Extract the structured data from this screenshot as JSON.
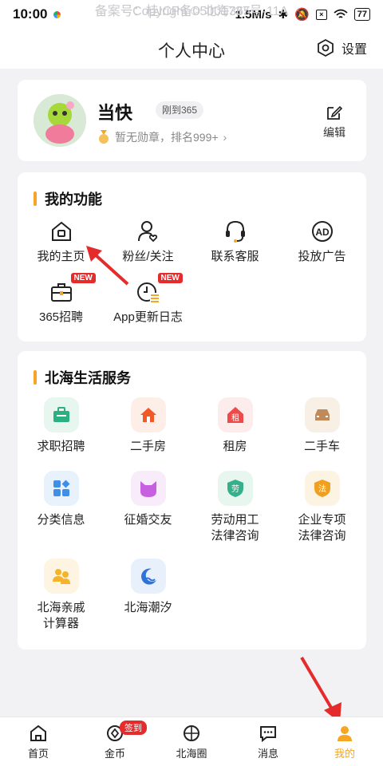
{
  "status": {
    "time": "10:00",
    "speed": "1.5M/s",
    "battery": "77"
  },
  "header": {
    "title": "个人中心",
    "settings_label": "设置"
  },
  "profile": {
    "name": "当快",
    "badge": "刚到365",
    "medal_text": "暂无勋章，排名999+",
    "edit_label": "编辑"
  },
  "functions": {
    "title": "我的功能",
    "items": [
      {
        "label": "我的主页",
        "icon": "home-icon"
      },
      {
        "label": "粉丝/关注",
        "icon": "user-heart-icon"
      },
      {
        "label": "联系客服",
        "icon": "headset-icon"
      },
      {
        "label": "投放广告",
        "icon": "ad-icon"
      },
      {
        "label": "365招聘",
        "icon": "briefcase-icon",
        "tag": "NEW"
      },
      {
        "label": "App更新日志",
        "icon": "clock-list-icon",
        "tag": "NEW"
      }
    ]
  },
  "services": {
    "title": "北海生活服务",
    "items": [
      {
        "label": "求职招聘",
        "color": "#2bb07f",
        "bg": "#e7f6ef"
      },
      {
        "label": "二手房",
        "color": "#f05a28",
        "bg": "#fdeee7"
      },
      {
        "label": "租房",
        "color": "#ee4a4a",
        "bg": "#fdecec",
        "glyph": "租"
      },
      {
        "label": "二手车",
        "color": "#c08a5a",
        "bg": "#f8efe5"
      },
      {
        "label": "分类信息",
        "color": "#3d8fe8",
        "bg": "#e8f2fd"
      },
      {
        "label": "征婚交友",
        "color": "#c660e0",
        "bg": "#f8ecfb"
      },
      {
        "label": "劳动用工",
        "label2": "法律咨询",
        "color": "#35b08a",
        "bg": "#e8f6f0",
        "glyph": "劳"
      },
      {
        "label": "企业专项",
        "label2": "法律咨询",
        "color": "#f0a020",
        "bg": "#fdf3e2",
        "glyph": "法"
      },
      {
        "label": "北海亲戚",
        "label2": "计算器",
        "color": "#f5b32a",
        "bg": "#fdf4e2"
      },
      {
        "label": "北海潮汐",
        "color": "#2f73d8",
        "bg": "#e8f0fc"
      }
    ]
  },
  "footer": {
    "record": "备案号：桂ICP备05001737号-11A",
    "copyright": "Copyright © 北海365"
  },
  "nav": {
    "tabs": [
      {
        "label": "首页",
        "icon": "home-icon"
      },
      {
        "label": "金币",
        "icon": "coin-icon",
        "badge": "签到"
      },
      {
        "label": "北海圈",
        "icon": "circle-icon"
      },
      {
        "label": "消息",
        "icon": "message-icon"
      },
      {
        "label": "我的",
        "icon": "person-icon",
        "active": true
      }
    ]
  }
}
